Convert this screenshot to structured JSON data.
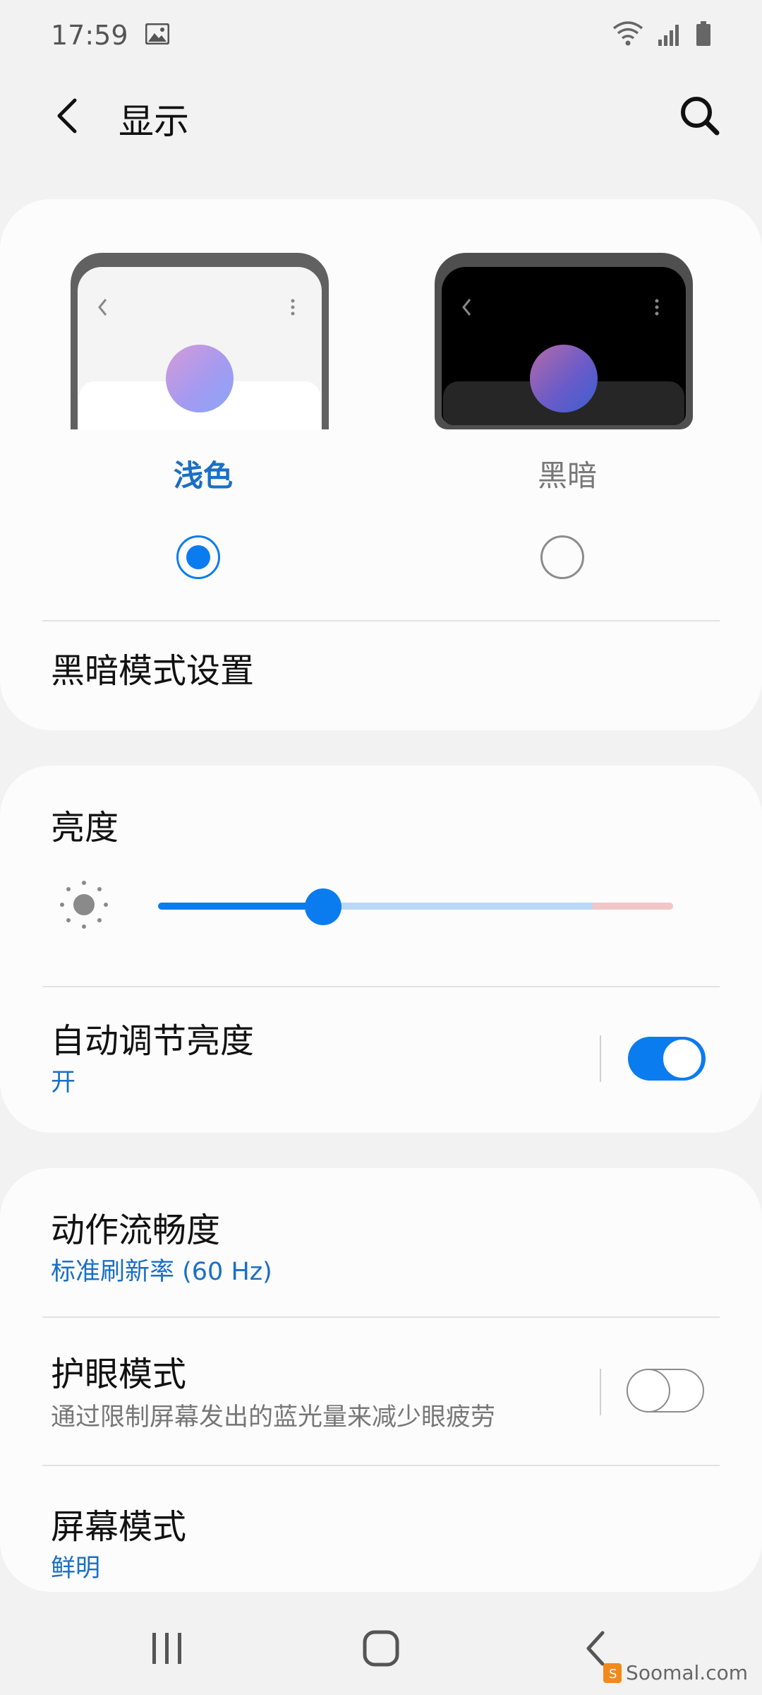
{
  "status_bar": {
    "time": "17:59"
  },
  "app_bar": {
    "title": "显示"
  },
  "theme": {
    "light_label": "浅色",
    "dark_label": "黑暗",
    "selected": "light"
  },
  "dark_mode_settings": {
    "label": "黑暗模式设置"
  },
  "brightness": {
    "title": "亮度",
    "level": 0.32
  },
  "auto_brightness": {
    "title": "自动调节亮度",
    "status": "开",
    "enabled": true
  },
  "motion_smoothness": {
    "title": "动作流畅度",
    "value": "标准刷新率 (60 Hz)"
  },
  "eye_comfort": {
    "title": "护眼模式",
    "description": "通过限制屏幕发出的蓝光量来减少眼疲劳",
    "enabled": false
  },
  "screen_mode": {
    "title": "屏幕模式",
    "value": "鲜明"
  },
  "watermark": {
    "text": "Soomal.com"
  },
  "colors": {
    "accent": "#0a7cf0",
    "accent_text": "#1a6fc4",
    "slider_track_light": "#b9d8f8",
    "slider_track_warn": "#f2c6c6"
  }
}
